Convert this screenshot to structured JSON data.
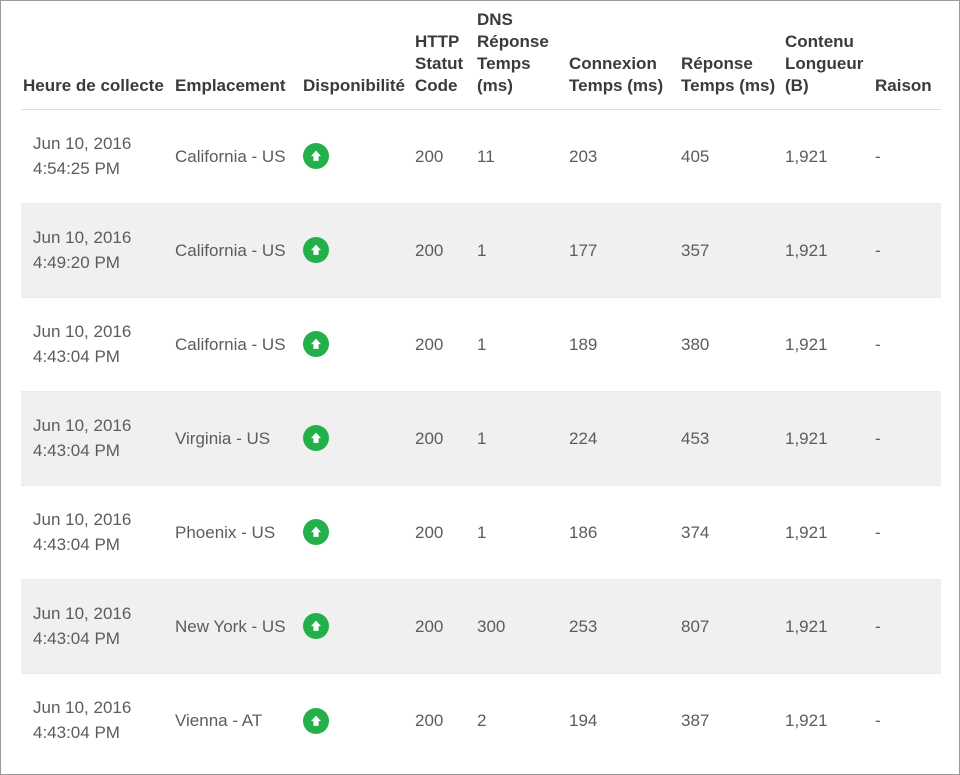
{
  "table": {
    "columns": [
      {
        "key": "collection_time",
        "label": "Heure de collecte"
      },
      {
        "key": "location",
        "label": "Emplacement"
      },
      {
        "key": "availability",
        "label": "Disponibilité"
      },
      {
        "key": "http_status",
        "label": "HTTP Statut Code"
      },
      {
        "key": "dns_time",
        "label": "DNS Réponse Temps (ms)"
      },
      {
        "key": "connect_time",
        "label": "Connexion Temps (ms)"
      },
      {
        "key": "response_time",
        "label": "Réponse Temps (ms)"
      },
      {
        "key": "content_length",
        "label": "Contenu Longueur (B)"
      },
      {
        "key": "reason",
        "label": "Raison"
      }
    ],
    "status_icon": {
      "name": "availability-up-arrow-icon",
      "color": "#23b04b",
      "glyph": "arrow-up"
    },
    "rows": [
      {
        "date": "Jun 10, 2016",
        "time": "4:54:25 PM",
        "location": "California - US",
        "availability": "up",
        "http_status": "200",
        "dns_time": "11",
        "connect_time": "203",
        "response_time": "405",
        "content_length": "1,921",
        "reason": "-"
      },
      {
        "date": "Jun 10, 2016",
        "time": "4:49:20 PM",
        "location": "California - US",
        "availability": "up",
        "http_status": "200",
        "dns_time": "1",
        "connect_time": "177",
        "response_time": "357",
        "content_length": "1,921",
        "reason": "-"
      },
      {
        "date": "Jun 10, 2016",
        "time": "4:43:04 PM",
        "location": "California - US",
        "availability": "up",
        "http_status": "200",
        "dns_time": "1",
        "connect_time": "189",
        "response_time": "380",
        "content_length": "1,921",
        "reason": "-"
      },
      {
        "date": "Jun 10, 2016",
        "time": "4:43:04 PM",
        "location": "Virginia - US",
        "availability": "up",
        "http_status": "200",
        "dns_time": "1",
        "connect_time": "224",
        "response_time": "453",
        "content_length": "1,921",
        "reason": "-"
      },
      {
        "date": "Jun 10, 2016",
        "time": "4:43:04 PM",
        "location": "Phoenix - US",
        "availability": "up",
        "http_status": "200",
        "dns_time": "1",
        "connect_time": "186",
        "response_time": "374",
        "content_length": "1,921",
        "reason": "-"
      },
      {
        "date": "Jun 10, 2016",
        "time": "4:43:04 PM",
        "location": "New York - US",
        "availability": "up",
        "http_status": "200",
        "dns_time": "300",
        "connect_time": "253",
        "response_time": "807",
        "content_length": "1,921",
        "reason": "-"
      },
      {
        "date": "Jun 10, 2016",
        "time": "4:43:04 PM",
        "location": "Vienna - AT",
        "availability": "up",
        "http_status": "200",
        "dns_time": "2",
        "connect_time": "194",
        "response_time": "387",
        "content_length": "1,921",
        "reason": "-"
      }
    ]
  }
}
